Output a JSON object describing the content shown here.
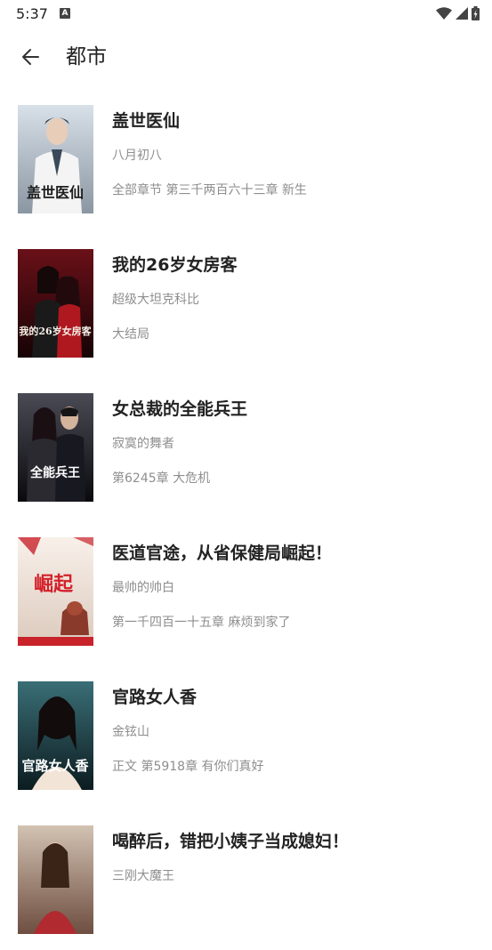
{
  "status_bar": {
    "time": "5:37",
    "notification_badge": "A",
    "icons": [
      "wifi-icon",
      "cell-signal-icon",
      "battery-icon"
    ]
  },
  "header": {
    "title": "都市",
    "back_icon": "arrow-left-icon"
  },
  "books": [
    {
      "title": "盖世医仙",
      "author": "八月初八",
      "chapter": "全部章节 第三千两百六十三章  新生",
      "cover_text": "盖世医仙",
      "cover_colors": [
        "#c9d3dc",
        "#7d8a96"
      ]
    },
    {
      "title": "我的26岁女房客",
      "author": "超级大坦克科比",
      "chapter": "大结局",
      "cover_text": "我的26岁女房客",
      "cover_colors": [
        "#5a0d12",
        "#1a0406"
      ]
    },
    {
      "title": "女总裁的全能兵王",
      "author": "寂寞的舞者",
      "chapter": "第6245章  大危机",
      "cover_text": "全能兵王",
      "cover_colors": [
        "#3a3a42",
        "#0c0c10"
      ]
    },
    {
      "title": "医道官途，从省保健局崛起！",
      "author": "最帅的帅白",
      "chapter": "第一千四百一十五章 麻烦到家了",
      "cover_text": "崛起",
      "cover_colors": [
        "#f4ebe4",
        "#d9c9bf"
      ]
    },
    {
      "title": "官路女人香",
      "author": "金铉山",
      "chapter": "正文 第5918章 有你们真好",
      "cover_text": "官路女人香",
      "cover_colors": [
        "#2f5f66",
        "#0f2226"
      ]
    },
    {
      "title": "喝醉后，错把小姨子当成媳妇！",
      "author": "三刚大魔王",
      "chapter": "",
      "cover_text": "",
      "cover_colors": [
        "#c7b6a6",
        "#7a5a4a"
      ]
    }
  ]
}
